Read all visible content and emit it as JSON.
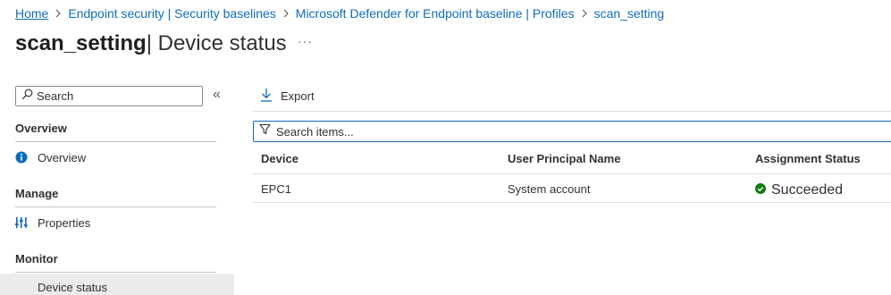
{
  "breadcrumb": {
    "items": [
      "Home",
      "Endpoint security | Security baselines",
      "Microsoft Defender for Endpoint baseline | Profiles",
      "scan_setting"
    ]
  },
  "header": {
    "title_main": "scan_setting",
    "title_sub": " | Device status",
    "more_label": "···"
  },
  "sidebar": {
    "search_placeholder": "Search",
    "collapse_label": "«",
    "sections": [
      {
        "heading": "Overview",
        "items": [
          {
            "label": "Overview",
            "icon": "info-icon"
          }
        ]
      },
      {
        "heading": "Manage",
        "items": [
          {
            "label": "Properties",
            "icon": "properties-icon"
          }
        ]
      },
      {
        "heading": "Monitor",
        "items": [
          {
            "label": "Device status",
            "icon": "none",
            "active": true
          }
        ]
      }
    ]
  },
  "toolbar": {
    "export_label": "Export",
    "export_icon": "download-icon"
  },
  "filter": {
    "placeholder": "Search items...",
    "icon": "filter-icon"
  },
  "table": {
    "columns": [
      "Device",
      "User Principal Name",
      "Assignment Status"
    ],
    "rows": [
      {
        "device": "EPC1",
        "upn": "System account",
        "status": "Succeeded",
        "status_icon": "check-circle-icon"
      }
    ]
  },
  "colors": {
    "link": "#0f6cbd",
    "success": "#107c10",
    "active_bg": "#edebe9",
    "info": "#0f6cbd"
  }
}
